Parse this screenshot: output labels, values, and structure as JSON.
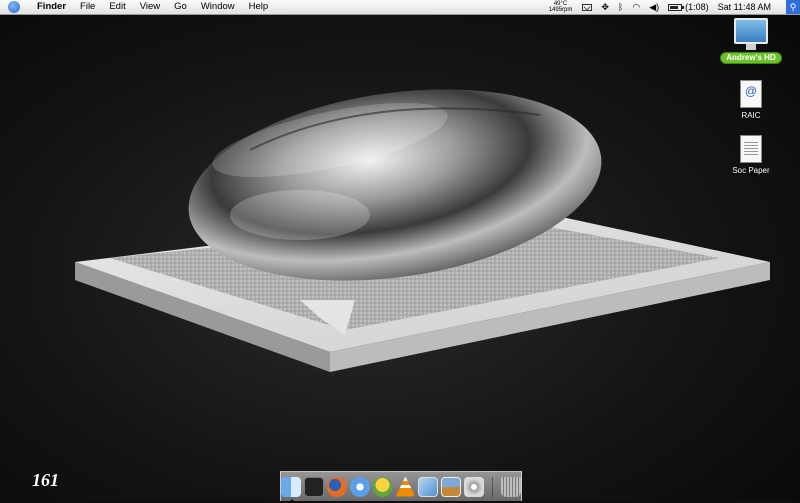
{
  "menubar": {
    "apple_icon": "apple-logo-icon",
    "items": [
      {
        "label": "Finder",
        "bold": true
      },
      {
        "label": "File"
      },
      {
        "label": "Edit"
      },
      {
        "label": "View"
      },
      {
        "label": "Go"
      },
      {
        "label": "Window"
      },
      {
        "label": "Help"
      }
    ],
    "temp_line1": "49°C",
    "temp_line2": "1495rpm",
    "battery_label": "(1:08)",
    "clock": "Sat 11:48 AM",
    "spotlight_icon": "spotlight-icon"
  },
  "desktop": {
    "icons": [
      {
        "label": "Andrew's HD",
        "icon": "hard-drive-icon"
      },
      {
        "label": "RAIC",
        "icon": "http-location-icon"
      },
      {
        "label": "Soc Paper",
        "icon": "document-icon"
      }
    ],
    "page_number": "161"
  },
  "dock": {
    "items": [
      "finder-icon",
      "terminal-icon",
      "firefox-icon",
      "itunes-icon",
      "adium-icon",
      "vlc-icon",
      "preview-icon",
      "iphoto-icon",
      "system-preferences-icon",
      "trash-icon"
    ]
  }
}
